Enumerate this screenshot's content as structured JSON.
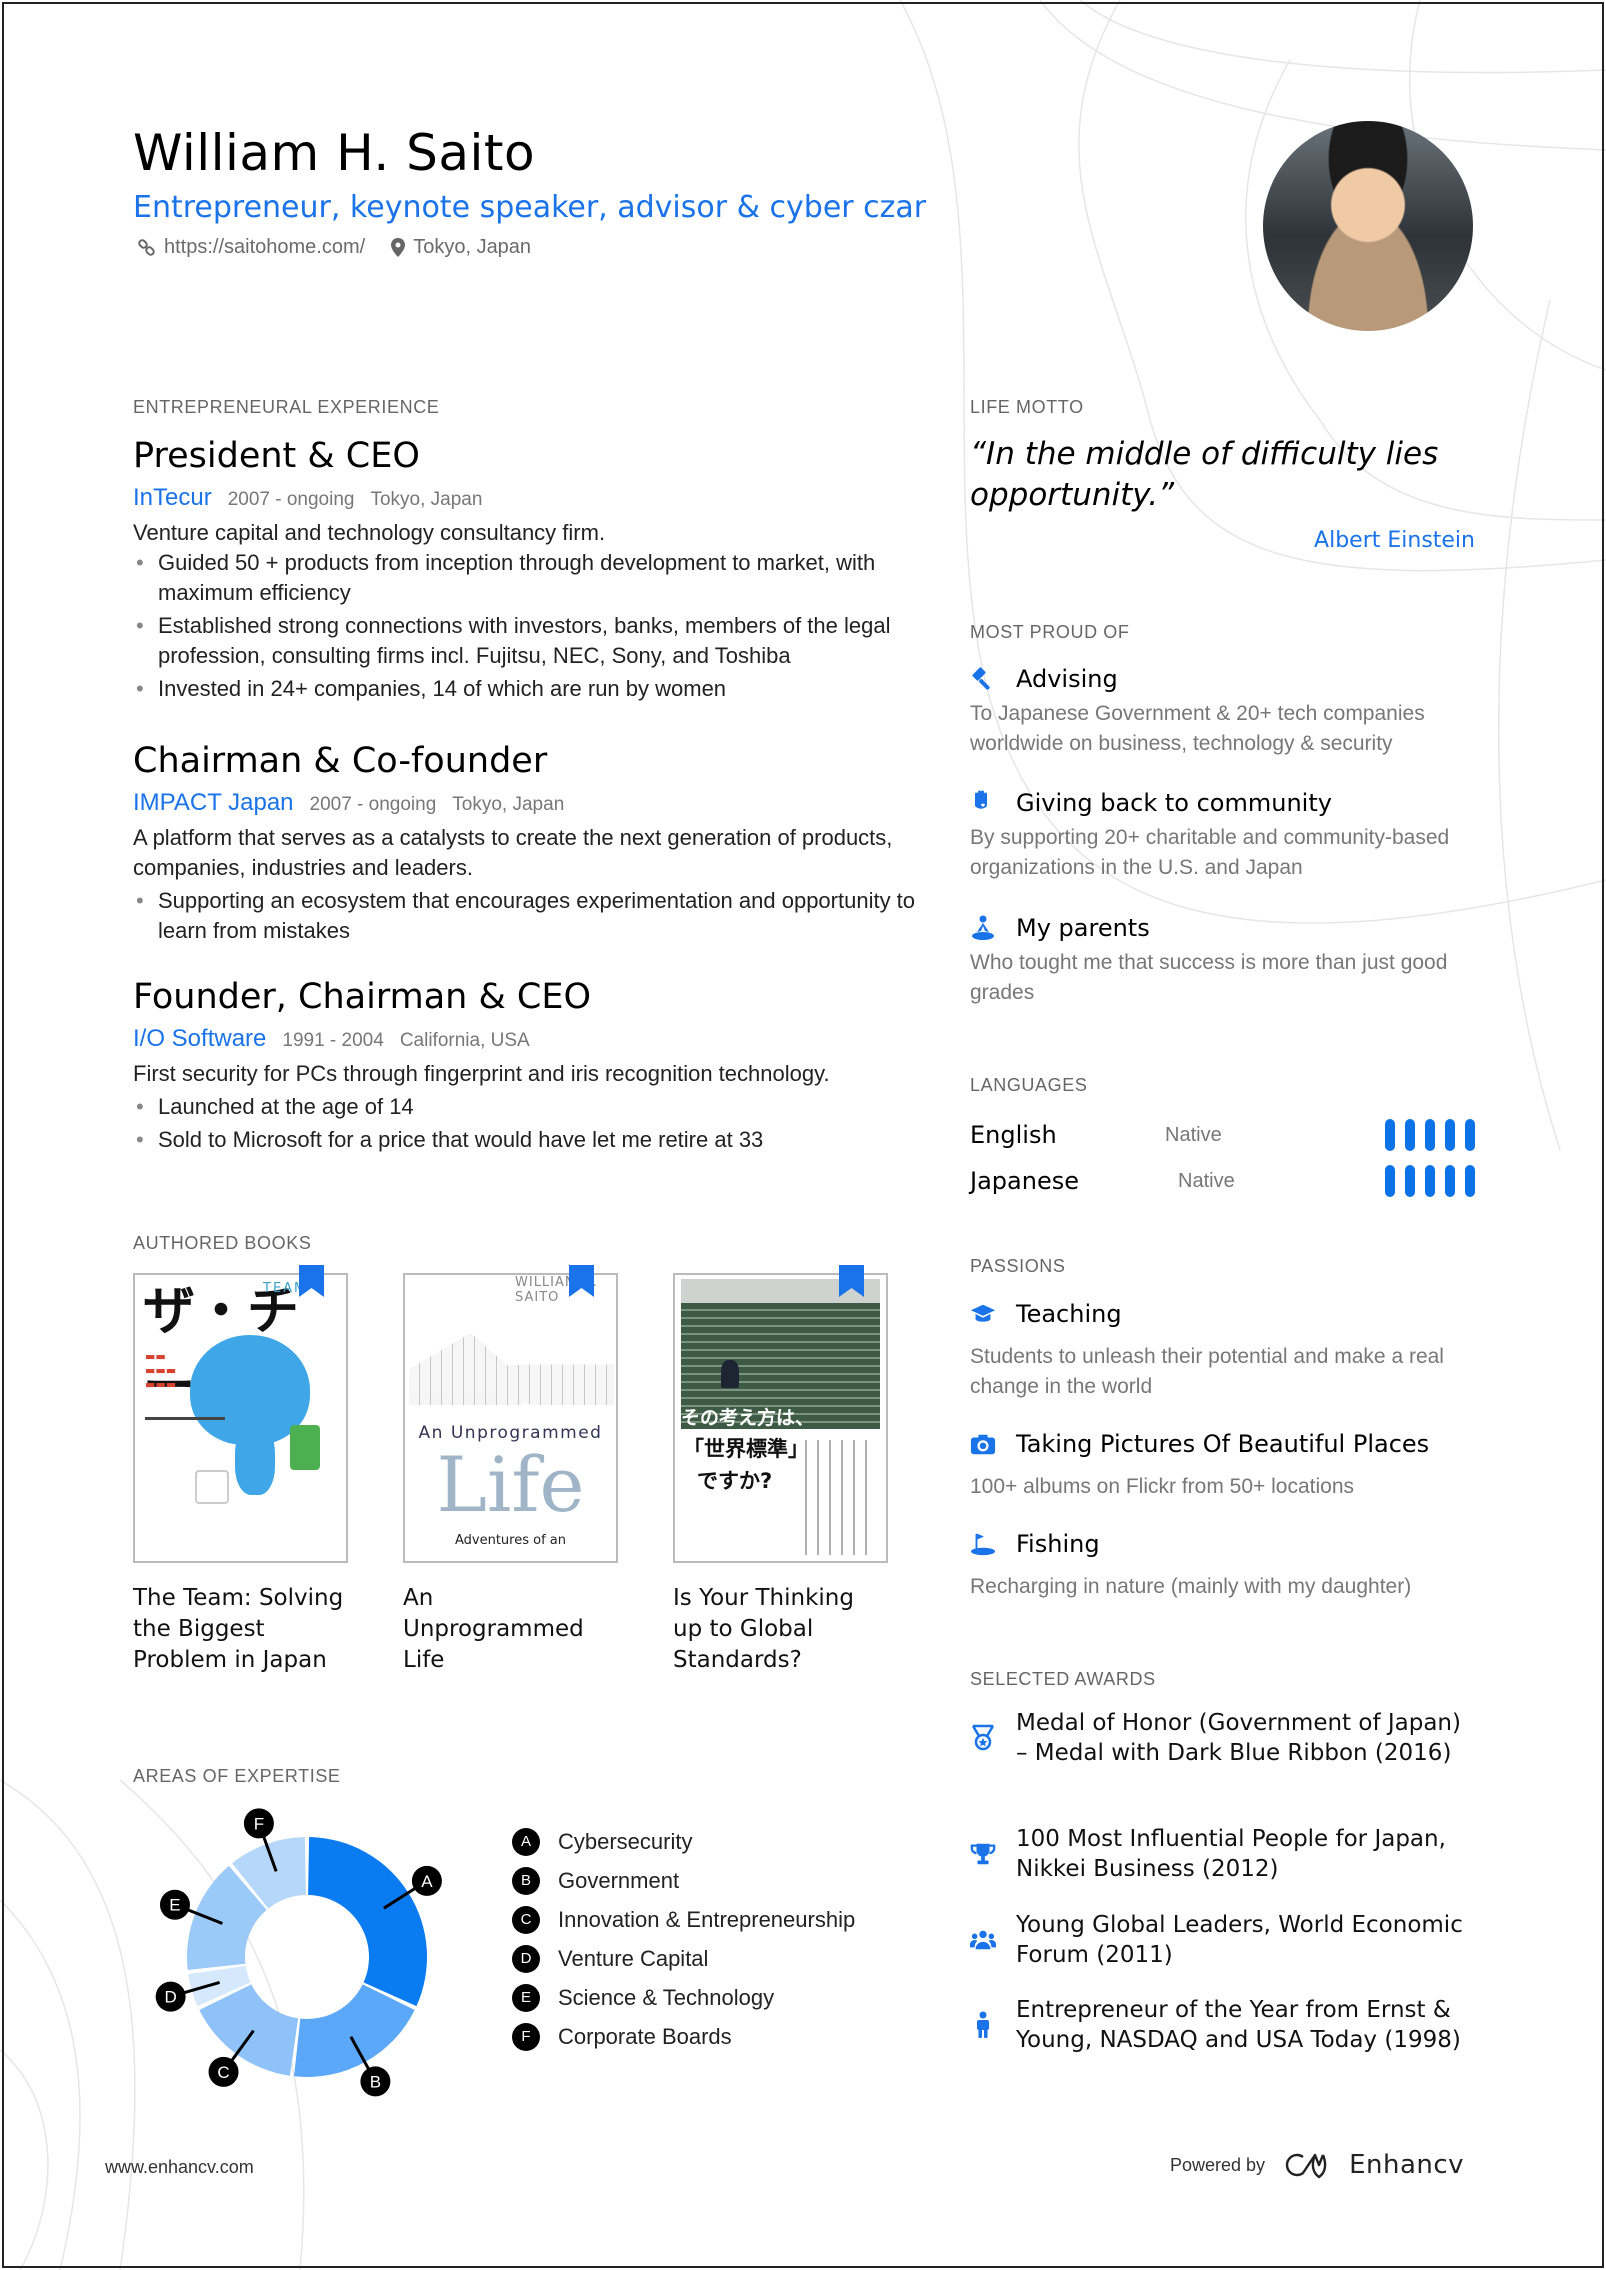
{
  "header": {
    "name": "William H. Saito",
    "subtitle": "Entrepreneur, keynote speaker, advisor & cyber czar",
    "website": "https://saitohome.com/",
    "location": "Tokyo, Japan",
    "accent_color": "#1a73e8"
  },
  "experience": {
    "title": "ENTREPRENEURAL EXPERIENCE",
    "jobs": [
      {
        "title": "President & CEO",
        "company": "InTecur",
        "dates": "2007 - ongoing",
        "location": "Tokyo, Japan",
        "description": "Venture capital and technology consultancy firm.",
        "bullets": [
          "Guided 50 + products from inception through development to market, with maximum efficiency",
          "Established strong connections with investors, banks, members of the legal profession, consulting firms incl. Fujitsu, NEC, Sony, and Toshiba",
          " Invested in 24+ companies, 14 of which are run by women"
        ]
      },
      {
        "title": "Chairman & Co-founder",
        "company": "IMPACT Japan",
        "dates": "2007 - ongoing",
        "location": "Tokyo, Japan",
        "description": "A platform that serves as a catalysts to create the next generation of products, companies, industries and leaders.",
        "bullets": [
          "Supporting an ecosystem that encourages experimentation and opportunity to learn from mistakes"
        ]
      },
      {
        "title": "Founder, Chairman & CEO",
        "company": "I/O Software",
        "dates": "1991 - 2004",
        "location": "California, USA",
        "description": "First security for PCs through fingerprint and iris recognition technology.",
        "bullets": [
          "Launched at the age of 14",
          "Sold to Microsoft for a price that would have let me retire at 33"
        ]
      }
    ]
  },
  "books": {
    "title": "AUTHORED BOOKS",
    "items": [
      {
        "title": "The Team: Solving the Biggest Problem in Japan",
        "cover_text": "ザ・チーム",
        "cover_sub": "TEAM"
      },
      {
        "title": "An Unprogrammed Life",
        "cover_text": "Life",
        "cover_sub": "An Unprogrammed",
        "cover_foot": "Adventures of an",
        "cover_author": "WILLIAM H. SAITO"
      },
      {
        "title": "Is Your Thinking up to Global Standards?",
        "cover_text": "「世界標準」",
        "cover_sub": "その考え方は、",
        "cover_foot": "ですか?"
      }
    ]
  },
  "expertise": {
    "title": "AREAS OF EXPERTISE"
  },
  "chart_data": {
    "type": "pie",
    "title": "AREAS OF EXPERTISE",
    "donut": true,
    "categories": [
      "A",
      "B",
      "C",
      "D",
      "E",
      "F"
    ],
    "labels": [
      "Cybersecurity",
      "Government",
      "Innovation & Entrepreneurship",
      "Venture Capital",
      "Science & Technology",
      "Corporate Boards"
    ],
    "values": [
      32,
      20,
      16,
      5,
      16,
      11
    ],
    "colors": [
      "#0b7bf2",
      "#5aa8f7",
      "#8fc2f8",
      "#d5e8fc",
      "#9ccaf8",
      "#b5d7fa"
    ],
    "legend": "right"
  },
  "motto": {
    "title": "LIFE MOTTO",
    "quote": "“In the middle of difficulty lies opportunity.”",
    "author": "Albert Einstein"
  },
  "proud": {
    "title": "MOST PROUD OF",
    "items": [
      {
        "icon": "gavel-icon",
        "title": "Advising",
        "text": "To Japanese Government & 20+ tech companies worldwide on business, technology & security"
      },
      {
        "icon": "hand-heart-icon",
        "title": "Giving back to community",
        "text": "By supporting 20+ charitable and community-based organizations in the U.S. and Japan"
      },
      {
        "icon": "meditation-person-icon",
        "title": "My parents",
        "text": "Who tought me that success is more than just good grades"
      }
    ]
  },
  "languages": {
    "title": "LANGUAGES",
    "items": [
      {
        "name": "English",
        "level": "Native",
        "rating": 5,
        "max": 5
      },
      {
        "name": "Japanese",
        "level": "Native",
        "rating": 5,
        "max": 5
      }
    ]
  },
  "passions": {
    "title": "PASSIONS",
    "items": [
      {
        "icon": "graduation-cap-icon",
        "title": "Teaching",
        "text": "Students to unleash their potential and make a real change in the world"
      },
      {
        "icon": "camera-icon",
        "title": "Taking Pictures Of Beautiful Places",
        "text": "100+ albums on Flickr from 50+ locations"
      },
      {
        "icon": "golf-flag-icon",
        "title": "Fishing",
        "text": "Recharging in nature (mainly with my daughter)"
      }
    ]
  },
  "awards": {
    "title": "SELECTED AWARDS",
    "items": [
      {
        "icon": "medal-icon",
        "text": "Medal of Honor (Government of Japan) – Medal with Dark Blue Ribbon (2016)"
      },
      {
        "icon": "trophy-icon",
        "text": "100 Most Influential People for Japan,  Nikkei Business (2012)"
      },
      {
        "icon": "group-icon",
        "text": "Young Global Leaders, World Economic Forum (2011)"
      },
      {
        "icon": "person-icon",
        "text": "Entrepreneur of the Year from Ernst & Young, NASDAQ and USA Today (1998)"
      }
    ]
  },
  "footer": {
    "website": "www.enhancv.com",
    "powered_by": "Powered by",
    "brand": "Enhancv"
  }
}
